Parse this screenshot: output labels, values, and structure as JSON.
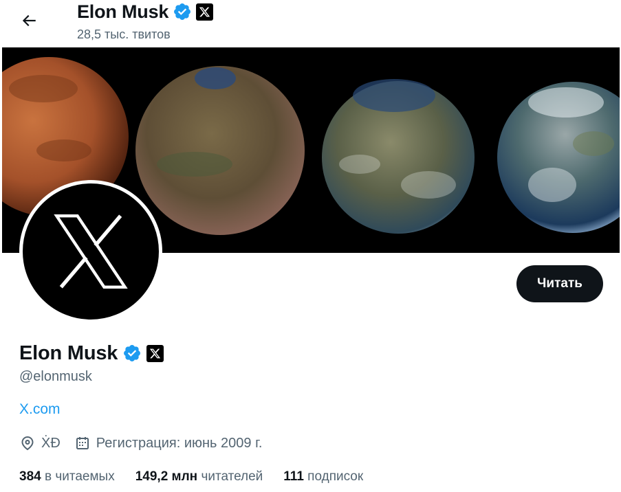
{
  "header": {
    "name": "Elon Musk",
    "tweet_count": "28,5 тыс. твитов"
  },
  "profile": {
    "name": "Elon Musk",
    "handle": "@elonmusk",
    "website": "X.com",
    "location": "ẊĐ",
    "joined": "Регистрация: июнь 2009 г.",
    "follow_label": "Читать"
  },
  "stats": {
    "following_count": "384",
    "following_label": "в читаемых",
    "followers_count": "149,2 млн",
    "followers_label": "читателей",
    "subscriptions_count": "111",
    "subscriptions_label": "подписок"
  },
  "colors": {
    "accent": "#1d9bf0",
    "verified": "#1d9bf0",
    "text_primary": "#0f1419",
    "text_secondary": "#536471",
    "button_bg": "#0f1419"
  },
  "icons": {
    "back": "arrow-left-icon",
    "verified": "verified-badge-icon",
    "affiliate": "x-logo-icon",
    "location": "map-pin-icon",
    "calendar": "calendar-icon"
  }
}
